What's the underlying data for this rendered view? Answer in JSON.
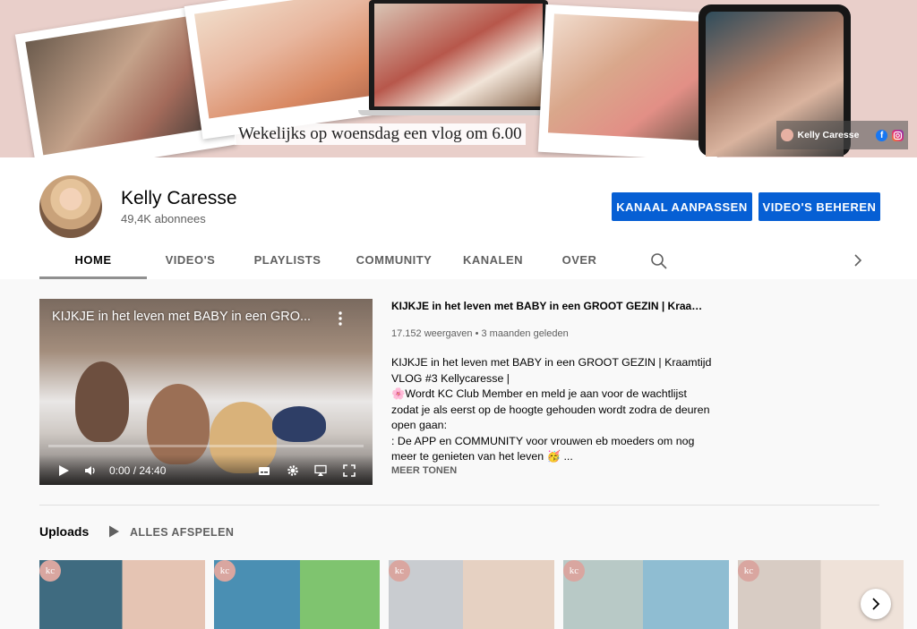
{
  "banner": {
    "tagline": "Wekelijks op woensdag een vlog om 6.00",
    "channel_link_name": "Kelly Caresse",
    "facebook_glyph": "f",
    "icons": [
      "facebook-icon",
      "instagram-icon"
    ]
  },
  "channel": {
    "name": "Kelly Caresse",
    "subscribers": "49,4K abonnees"
  },
  "actions": {
    "customize": "KANAAL AANPASSEN",
    "manage": "VIDEO'S BEHEREN"
  },
  "tabs": [
    {
      "label": "HOME",
      "active": true
    },
    {
      "label": "VIDEO'S",
      "active": false
    },
    {
      "label": "PLAYLISTS",
      "active": false
    },
    {
      "label": "COMMUNITY",
      "active": false
    },
    {
      "label": "KANALEN",
      "active": false
    },
    {
      "label": "OVER",
      "active": false
    }
  ],
  "featured": {
    "player_title": "KIJKJE in het leven met BABY in een GRO...",
    "time": "0:00 / 24:40",
    "title": "KIJKJE in het leven met BABY in een GROOT GEZIN | Kraamtij...",
    "meta": "17.152 weergaven • 3 maanden geleden",
    "description": [
      "KIJKJE in het leven met BABY in een GROOT GEZIN | Kraamtijd",
      "VLOG #3 Kellycaresse |",
      "🌸Wordt KC Club Member en meld je aan voor de wachtlijst",
      "zodat je als eerst op de hoogte gehouden wordt zodra de deuren",
      "open gaan:",
      ": De APP en COMMUNITY voor vrouwen eb moeders om nog",
      "meer te genieten van het leven  🥳 ..."
    ],
    "more": "MEER TONEN"
  },
  "uploads": {
    "title": "Uploads",
    "play_all": "ALLES AFSPELEN",
    "badge": "kc",
    "thumbnail_count_visible": 5
  },
  "colors": {
    "primary_button": "#065fd4",
    "banner_bg": "#e9cfca",
    "page_bg": "#f9f9f9"
  }
}
